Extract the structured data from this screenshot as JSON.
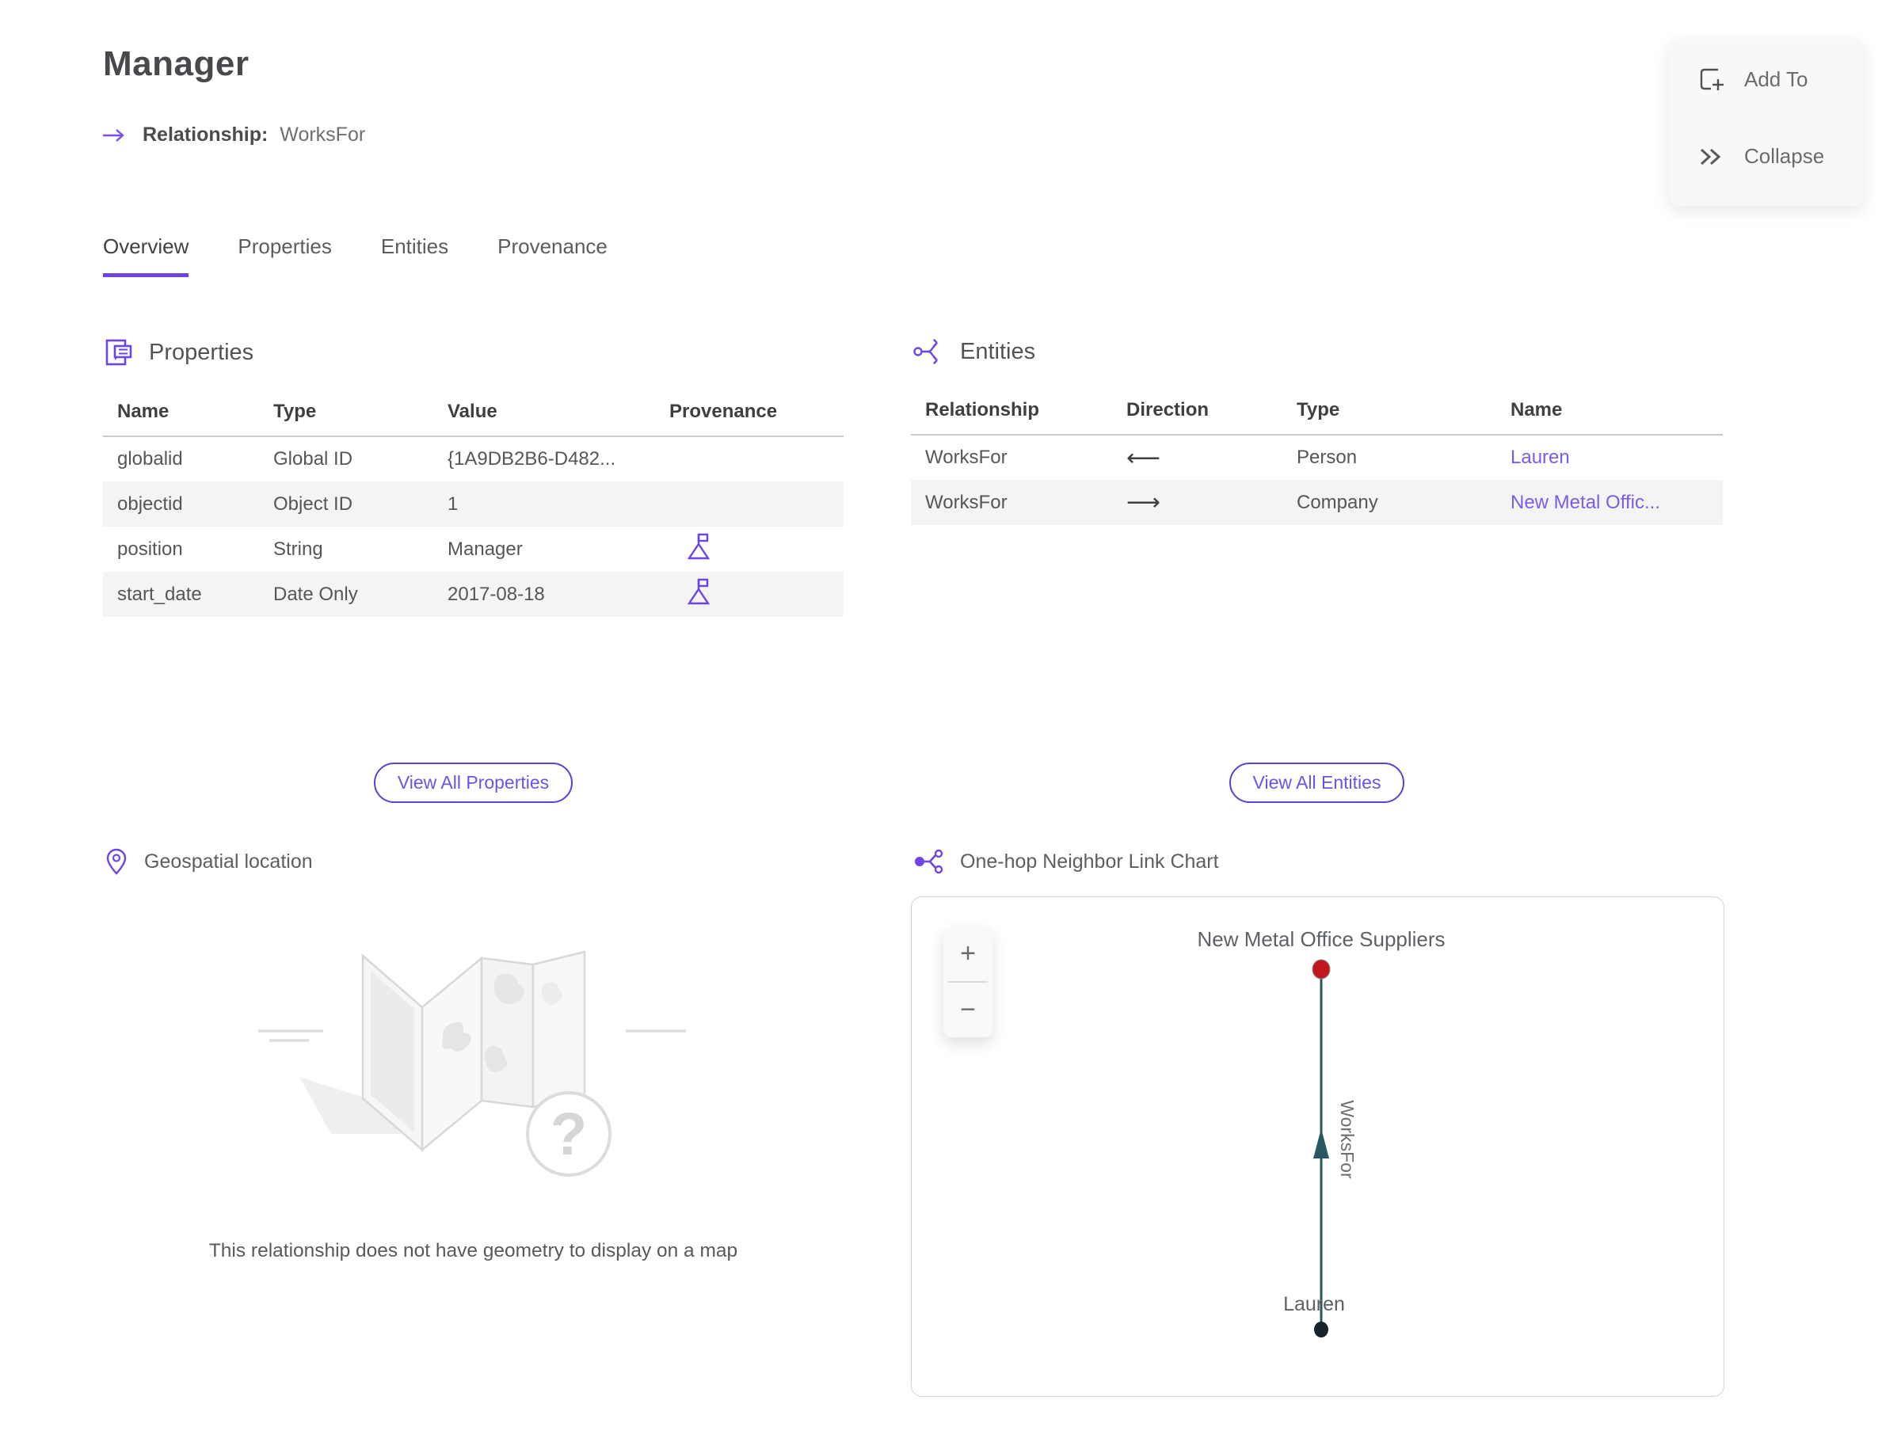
{
  "header": {
    "title": "Manager",
    "relationship_label": "Relationship:",
    "relationship_value": "WorksFor"
  },
  "actions": {
    "add_to_label": "Add To",
    "collapse_label": "Collapse"
  },
  "tabs": {
    "overview": "Overview",
    "properties": "Properties",
    "entities": "Entities",
    "provenance": "Provenance"
  },
  "properties_section": {
    "title": "Properties",
    "columns": {
      "name": "Name",
      "type": "Type",
      "value": "Value",
      "provenance": "Provenance"
    },
    "rows": [
      {
        "name": "globalid",
        "type": "Global ID",
        "value": "{1A9DB2B6-D482...",
        "provenance_flag": false
      },
      {
        "name": "objectid",
        "type": "Object ID",
        "value": "1",
        "provenance_flag": false
      },
      {
        "name": "position",
        "type": "String",
        "value": "Manager",
        "provenance_flag": true
      },
      {
        "name": "start_date",
        "type": "Date Only",
        "value": "2017-08-18",
        "provenance_flag": true
      }
    ],
    "view_all_label": "View All Properties"
  },
  "entities_section": {
    "title": "Entities",
    "columns": {
      "relationship": "Relationship",
      "direction": "Direction",
      "type": "Type",
      "name": "Name"
    },
    "rows": [
      {
        "relationship": "WorksFor",
        "direction": "⟵",
        "type": "Person",
        "name": "Lauren"
      },
      {
        "relationship": "WorksFor",
        "direction": "⟶",
        "type": "Company",
        "name": "New Metal Offic..."
      }
    ],
    "view_all_label": "View All Entities"
  },
  "geospatial_section": {
    "title": "Geospatial location",
    "placeholder_glyph": "?",
    "empty_message": "This relationship does not have geometry to display on a map"
  },
  "link_chart_section": {
    "title": "One-hop Neighbor Link Chart",
    "zoom_in_label": "+",
    "zoom_out_label": "−",
    "top_node_label": "New Metal Office Suppliers",
    "bottom_node_label": "Lauren",
    "edge_label": "WorksFor",
    "colors": {
      "top_node": "#c3161c",
      "bottom_node": "#17242d",
      "edge": "#275762"
    }
  },
  "colors": {
    "accent_purple": "#6d45e3",
    "link_purple": "#7a5ce8"
  }
}
